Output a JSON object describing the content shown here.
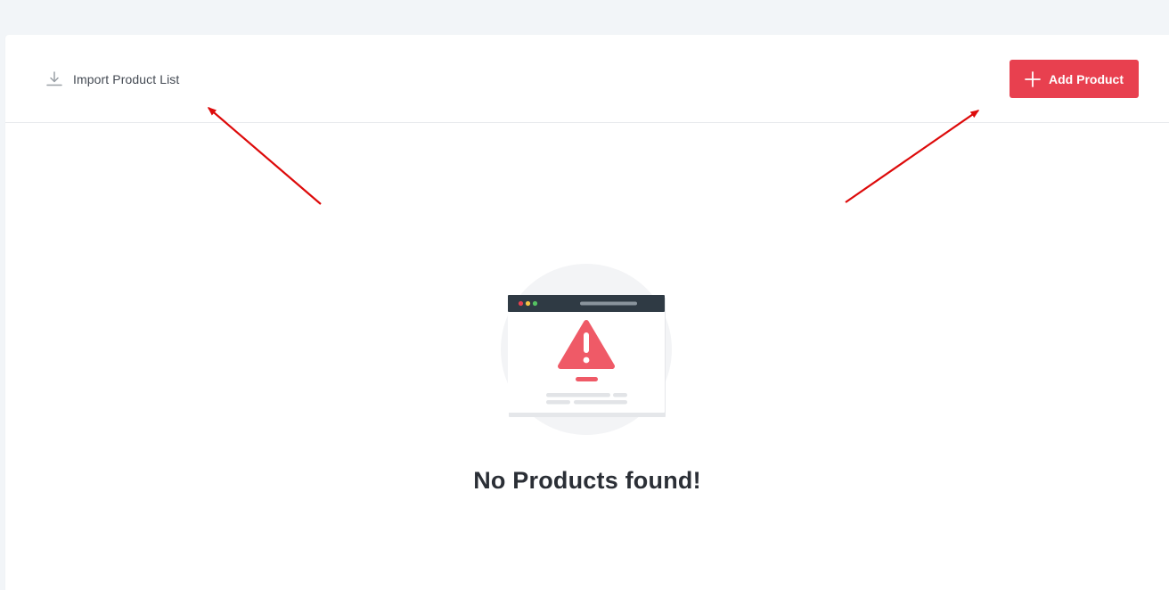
{
  "toolbar": {
    "import_label": "Import Product List",
    "add_label": "Add Product"
  },
  "empty_state": {
    "title": "No Products found!"
  },
  "icons": {
    "import": "download-icon",
    "add": "plus-icon",
    "empty": "browser-warning-illustration"
  },
  "colors": {
    "page_background": "#f2f5f8",
    "card_background": "#ffffff",
    "accent": "#e8404f",
    "warning": "#ef5a67",
    "annotation_arrow": "#dd0a0a",
    "title_text": "#2b2f36"
  }
}
